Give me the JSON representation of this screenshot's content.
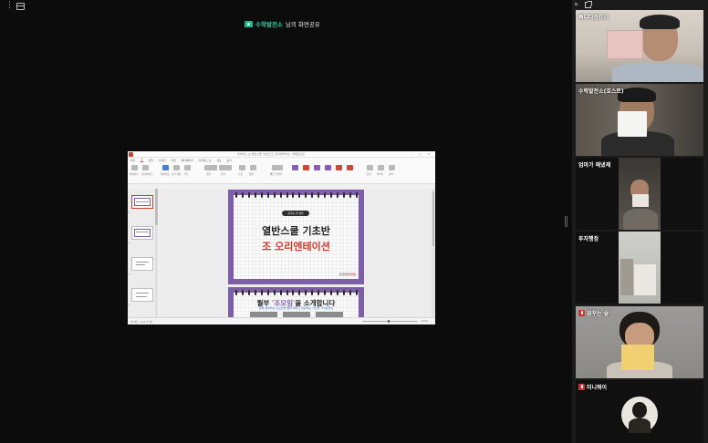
{
  "topbar": {
    "menu_icon": "more-vertical-icon",
    "window_icon": "window-icon"
  },
  "share_banner": {
    "presenter": "수학발전소",
    "suffix": "님의 화면공유"
  },
  "shared_screen": {
    "window_title": "슬라이드 쇼   열반스쿨 기초반 조 오리엔테이션   - 파워포인트",
    "window_buttons": "– □ ✕",
    "tabs": [
      "파일",
      "홈",
      "삽입",
      "디자인",
      "전환",
      "애니메이션",
      "슬라이드 쇼",
      "검토",
      "보기"
    ],
    "active_tab": "홈",
    "ribbon_labels": [
      "붙여넣기",
      "새 슬라이드",
      "레이아웃",
      "다시 설정",
      "구역",
      "글꼴",
      "단락",
      "도형",
      "정렬",
      "빠른 스타일",
      "찾기",
      "바꾸기",
      "선택"
    ],
    "slide_numbers": [
      "1",
      "2",
      "3",
      "4"
    ],
    "slide1": {
      "pill": "공부는 안 망함",
      "title": "열반스쿨 기초반",
      "subtitle": "조 오리엔테이션",
      "brand_prefix": "월급쟁이",
      "brand_suffix": "부자들"
    },
    "slide2": {
      "title_prefix": "월부 ",
      "title_highlight": "'조모임'",
      "title_suffix": "을 소개합니다",
      "desc": "함께 공부하는 조모임을 통해 배우고 성장하는 시간을 가져보세요"
    },
    "status_left": "슬라이드 1/24   한국어",
    "status_right": "100%"
  },
  "panel": {
    "collapse_icon": "chevrons-right-icon",
    "popout_icon": "external-window-icon"
  },
  "participants": [
    {
      "name": "빠니다정(나)",
      "muted": false
    },
    {
      "name": "수학발전소(호스트)",
      "muted": false
    },
    {
      "name": "엄마가 해냈제",
      "muted": false
    },
    {
      "name": "투자행정",
      "muted": false
    },
    {
      "name": "꿈꾸는 숲",
      "muted": true
    },
    {
      "name": "미니뭐이",
      "muted": true
    }
  ],
  "colors": {
    "share_green": "#35c79f",
    "slide_purple": "#7d5ea8",
    "accent_red": "#d33b2e",
    "muted_red": "#c8372d"
  }
}
